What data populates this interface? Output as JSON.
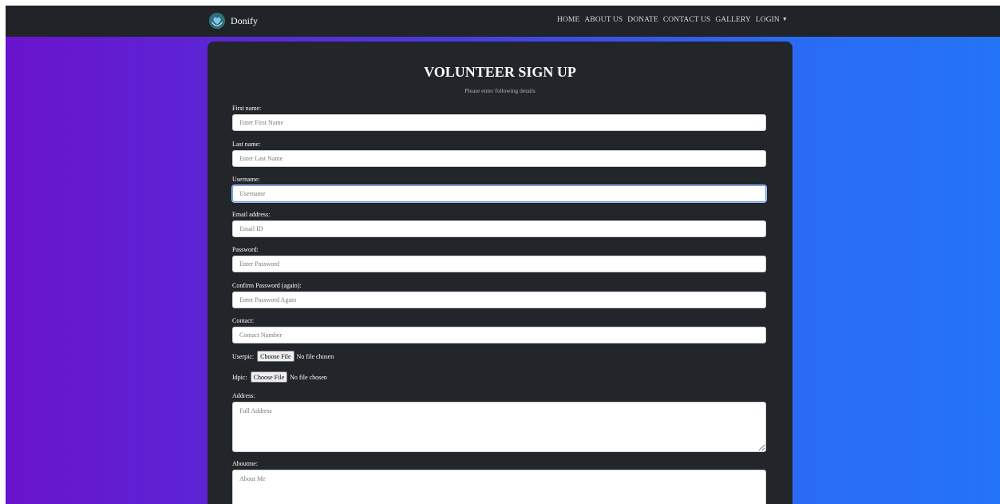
{
  "nav": {
    "brand": "Donify",
    "links": [
      "HOME",
      "ABOUT US",
      "DONATE",
      "CONTACT US",
      "GALLERY",
      "LOGIN"
    ]
  },
  "form": {
    "title": "VOLUNTEER SIGN UP",
    "subtitle": "Please enter following details",
    "first_name": {
      "label": "First name:",
      "placeholder": "Enter First Name"
    },
    "last_name": {
      "label": "Last name:",
      "placeholder": "Enter Last Name"
    },
    "username": {
      "label": "Username:",
      "placeholder": "Username"
    },
    "email": {
      "label": "Email address:",
      "placeholder": "Email ID"
    },
    "password": {
      "label": "Password:",
      "placeholder": "Enter Password"
    },
    "confirm_password": {
      "label": "Confirm Password (again):",
      "placeholder": "Enter Password Again"
    },
    "contact": {
      "label": "Contact:",
      "placeholder": "Contact Number"
    },
    "userpic": {
      "label": "Userpic:",
      "button": "Choose File",
      "status": "No file chosen"
    },
    "idpic": {
      "label": "Idpic:",
      "button": "Choose File",
      "status": "No file chosen"
    },
    "address": {
      "label": "Address:",
      "placeholder": "Full Address"
    },
    "aboutme": {
      "label": "Aboutme:",
      "placeholder": "About Me"
    }
  },
  "colors": {
    "navbar": "#202327",
    "card": "#222529",
    "gradient_left": "#6a13cc",
    "gradient_right": "#2474f7"
  }
}
